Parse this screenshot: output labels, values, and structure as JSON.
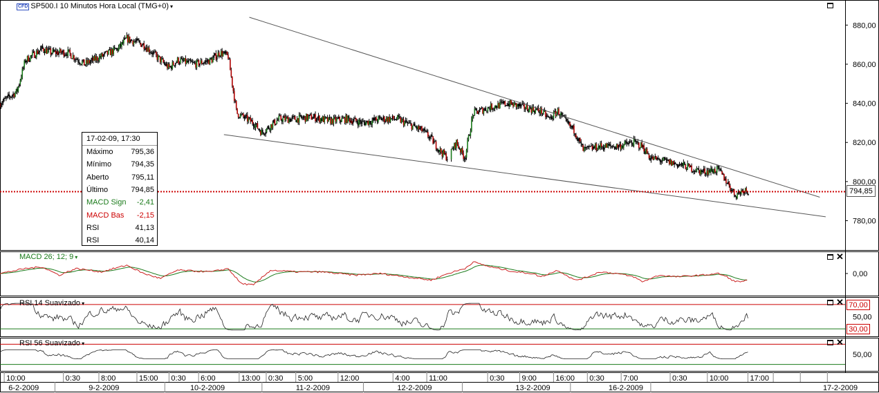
{
  "header": {
    "cfd_badge": "CFD",
    "title": "SP500.I 10 Minutos Hora Local (TMG+0)",
    "caret": "▾"
  },
  "info_box": {
    "datetime": "17-02-09, 17:30",
    "rows": [
      {
        "label": "Máximo",
        "value": "795,36",
        "color": "#000000"
      },
      {
        "label": "Mínimo",
        "value": "794,35",
        "color": "#000000"
      },
      {
        "label": "Aberto",
        "value": "795,11",
        "color": "#000000"
      },
      {
        "label": "Último",
        "value": "794,85",
        "color": "#000000"
      },
      {
        "label": "MACD Sign",
        "value": "-2,41",
        "color": "#1a7a1a"
      },
      {
        "label": "MACD Bas",
        "value": "-2,15",
        "color": "#cc0000"
      },
      {
        "label": "RSI",
        "value": "41,13",
        "color": "#000000"
      },
      {
        "label": "RSI",
        "value": "40,14",
        "color": "#000000"
      }
    ]
  },
  "panels": {
    "macd_label": "MACD 26; 12; 9",
    "rsi14_label": "RSI 14 Suavizado",
    "rsi56_label": "RSI 56 Suavizado",
    "close_glyph": "✕"
  },
  "colors": {
    "candle_up": "#1a7a1a",
    "candle_down": "#b00000",
    "macd_line": "#cc2222",
    "macd_signal": "#1a7a1a",
    "last_price_line": "#cc0000",
    "rsi_upper": "#cc0000",
    "rsi_lower": "#1a7a1a",
    "trendline": "#555555"
  },
  "chart_data": [
    {
      "type": "candlestick",
      "title": "SP500.I 10 Minutos Hora Local (TMG+0)",
      "ylim": [
        765,
        890
      ],
      "yticks": [
        780,
        800,
        820,
        840,
        860,
        880
      ],
      "ytick_labels": [
        "780,00",
        "800,00",
        "820,00",
        "840,00",
        "860,00",
        "880,00"
      ],
      "last_price": 794.85,
      "last_price_label": "794,85",
      "close_path": [
        [
          0,
          840
        ],
        [
          2,
          846
        ],
        [
          3,
          862
        ],
        [
          5,
          868
        ],
        [
          6,
          866
        ],
        [
          8,
          866
        ],
        [
          10,
          860
        ],
        [
          12,
          864
        ],
        [
          14,
          868
        ],
        [
          15,
          873
        ],
        [
          17,
          870
        ],
        [
          18,
          866
        ],
        [
          20,
          858
        ],
        [
          21,
          862
        ],
        [
          23,
          860
        ],
        [
          25,
          862
        ],
        [
          26,
          866
        ],
        [
          27,
          864
        ],
        [
          28,
          835
        ],
        [
          30,
          830
        ],
        [
          31,
          825
        ],
        [
          33,
          832
        ],
        [
          35,
          832
        ],
        [
          37,
          833
        ],
        [
          39,
          831
        ],
        [
          41,
          832
        ],
        [
          43,
          830
        ],
        [
          45,
          832
        ],
        [
          47,
          832
        ],
        [
          49,
          828
        ],
        [
          50,
          826
        ],
        [
          51,
          822
        ],
        [
          52,
          816
        ],
        [
          53,
          812
        ],
        [
          54,
          820
        ],
        [
          55,
          812
        ],
        [
          56,
          835
        ],
        [
          58,
          838
        ],
        [
          60,
          840
        ],
        [
          61,
          839
        ],
        [
          62,
          838
        ],
        [
          64,
          836
        ],
        [
          65,
          832
        ],
        [
          66,
          836
        ],
        [
          67,
          830
        ],
        [
          68,
          826
        ],
        [
          69,
          816
        ],
        [
          71,
          818
        ],
        [
          73,
          818
        ],
        [
          75,
          820
        ],
        [
          76,
          818
        ],
        [
          77,
          812
        ],
        [
          79,
          810
        ],
        [
          81,
          808
        ],
        [
          83,
          805
        ],
        [
          85,
          806
        ],
        [
          86,
          800
        ],
        [
          87,
          793
        ],
        [
          88,
          796
        ],
        [
          88.6,
          795
        ]
      ],
      "trendlines": [
        {
          "name": "upper",
          "points": [
            [
              29.5,
              884
            ],
            [
              97,
              792
            ]
          ]
        },
        {
          "name": "lower",
          "points": [
            [
              26.5,
              824
            ],
            [
              97.7,
              782
            ]
          ]
        }
      ],
      "x_tick_labels": [
        "10:00",
        "0:30",
        "8:00",
        "15:00",
        "0:30",
        "6:00",
        "13:00",
        "0:30",
        "5:00",
        "12:00",
        "4:00",
        "11:00",
        "0:30",
        "9:00",
        "16:00",
        "0:30",
        "7:00",
        "0:30",
        "10:00",
        "17:00"
      ],
      "x_tick_positions": [
        0.5,
        7.5,
        11.7,
        16.2,
        20,
        23.5,
        28.3,
        31.5,
        35,
        40,
        46.5,
        50.5,
        57.7,
        61.5,
        65.5,
        69.5,
        73.5,
        79.3,
        83.7,
        88.5
      ],
      "date_labels": [
        "6-2-2009",
        "9-2-2009",
        "10-2-2009",
        "11-2-2009",
        "12-2-2009",
        "13-2-2009",
        "16-2-2009",
        "17-2-2009"
      ],
      "date_positions": [
        1,
        10.5,
        22.5,
        35,
        47,
        61,
        72,
        99.5
      ],
      "date_dividers": [
        6.5,
        19.5,
        31,
        43,
        54.7,
        67.5,
        77
      ]
    },
    {
      "type": "line",
      "name": "MACD 26; 12; 9",
      "ylim": [
        -5,
        5
      ],
      "ytick_labels": [
        "0,00"
      ],
      "macd_path": [
        [
          0,
          0
        ],
        [
          3,
          1.5
        ],
        [
          5,
          2
        ],
        [
          7,
          -0.5
        ],
        [
          9,
          1.5
        ],
        [
          12,
          0.5
        ],
        [
          15,
          2.5
        ],
        [
          17,
          0
        ],
        [
          19,
          -1.5
        ],
        [
          21,
          1
        ],
        [
          25,
          0.5
        ],
        [
          27,
          1.5
        ],
        [
          28.5,
          -3
        ],
        [
          30,
          -3.5
        ],
        [
          32,
          1
        ],
        [
          35,
          0.5
        ],
        [
          38,
          0.5
        ],
        [
          40,
          0
        ],
        [
          42,
          -0.5
        ],
        [
          45,
          0
        ],
        [
          48,
          -1
        ],
        [
          51,
          -2
        ],
        [
          53,
          0
        ],
        [
          55,
          1.5
        ],
        [
          56,
          3.5
        ],
        [
          58,
          2
        ],
        [
          61,
          0.5
        ],
        [
          63,
          0
        ],
        [
          64,
          -1
        ],
        [
          66,
          1
        ],
        [
          68,
          -2
        ],
        [
          69,
          -1.5
        ],
        [
          71,
          0.5
        ],
        [
          73,
          0
        ],
        [
          75,
          -1
        ],
        [
          76,
          -2.5
        ],
        [
          78,
          -0.5
        ],
        [
          80,
          -1
        ],
        [
          83,
          -0.5
        ],
        [
          85,
          0
        ],
        [
          86,
          -1
        ],
        [
          87,
          -2.5
        ],
        [
          88.5,
          -2.15
        ]
      ]
    },
    {
      "type": "line",
      "name": "RSI 14 Suavizado",
      "ylim": [
        20,
        80
      ],
      "reference_levels": [
        70,
        30
      ],
      "ytick_labels": [
        "70,00",
        "50,00",
        "30,00"
      ]
    },
    {
      "type": "line",
      "name": "RSI 56 Suavizado",
      "ylim": [
        20,
        80
      ],
      "reference_levels": [
        70,
        30
      ],
      "ytick_labels": [
        "50,00"
      ]
    }
  ]
}
